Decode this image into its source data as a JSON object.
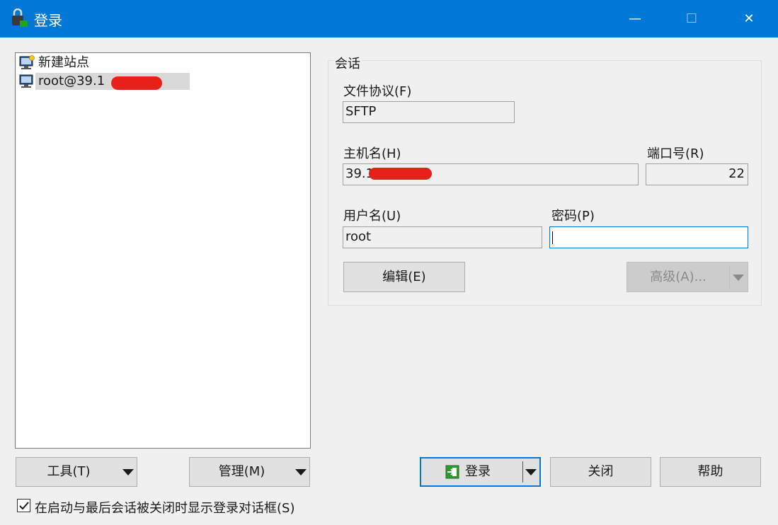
{
  "window": {
    "title": "登录",
    "icon": "lock-computer-icon"
  },
  "titlebar_buttons": {
    "minimize": "—",
    "maximize": "☐",
    "close": "✕"
  },
  "site_tree": {
    "items": [
      {
        "label": "新建站点",
        "icon": "new-site-computer-icon",
        "selected": false
      },
      {
        "label": "root@39.1",
        "icon": "computer-icon",
        "selected": true
      }
    ]
  },
  "session": {
    "legend": "会话",
    "protocol_label": "文件协议(F)",
    "protocol_value": "SFTP",
    "host_label": "主机名(H)",
    "host_value": "39.1",
    "port_label": "端口号(R)",
    "port_value": "22",
    "user_label": "用户名(U)",
    "user_value": "root",
    "password_label": "密码(P)",
    "password_value": "",
    "edit_button": "编辑(E)",
    "advanced_button": "高级(A)..."
  },
  "bottom": {
    "tools_button": "工具(T)",
    "manage_button": "管理(M)",
    "login_button": "登录",
    "close_button": "关闭",
    "help_button": "帮助",
    "checkbox_label": "在启动与最后会话被关闭时显示登录对话框(S)",
    "checkbox_checked": true
  },
  "colors": {
    "titlebar": "#0078d7",
    "redaction": "#e8201a",
    "focus": "#0078d7"
  }
}
